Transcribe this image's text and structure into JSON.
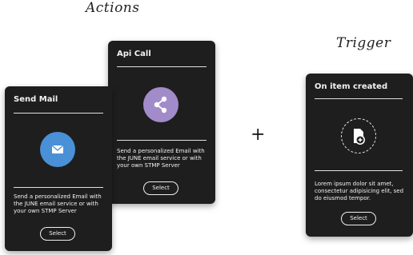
{
  "headings": {
    "actions": "Actions",
    "trigger": "Trigger"
  },
  "cards": {
    "send_mail": {
      "title": "Send Mail",
      "icon": "envelope-icon",
      "icon_color": "#4a90d6",
      "description": "Send a personalized Email with the JUNE email service or with your own STMP Server",
      "button": "Select"
    },
    "api_call": {
      "title": "Api Call",
      "icon": "share-icon",
      "icon_color": "#a28bc9",
      "description": "Send a personalized Email with the JUNE email service or with your own STMP Server",
      "button": "Select"
    },
    "trigger": {
      "title": "On item created",
      "icon": "add-document-icon",
      "description": "Lorem ipsum dolor sit amet, consectetur adipisicing elit, sed do eiusmod tempor.",
      "button": "Select"
    }
  },
  "connector": "+"
}
